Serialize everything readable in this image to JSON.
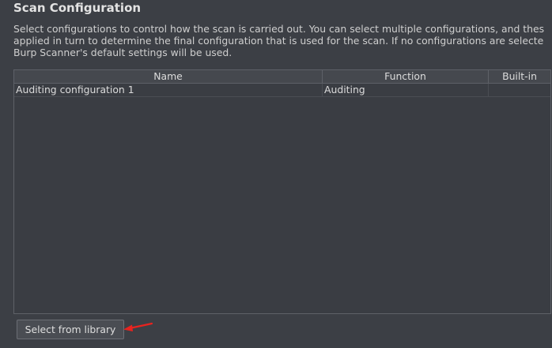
{
  "section": {
    "title": "Scan Configuration",
    "description_lines": [
      "Select configurations to control how the scan is carried out. You can select multiple configurations, and thes",
      "applied in turn to determine the final configuration that is used for the scan. If no configurations are selecte",
      "Burp Scanner's default settings will be used."
    ]
  },
  "table": {
    "columns": [
      "Name",
      "Function",
      "Built-in"
    ],
    "rows": [
      {
        "name": "Auditing configuration 1",
        "function": "Auditing",
        "builtin": ""
      }
    ]
  },
  "buttons": {
    "select_from_library": "Select from library"
  },
  "annotation": {
    "arrow_color": "#e8231f"
  }
}
